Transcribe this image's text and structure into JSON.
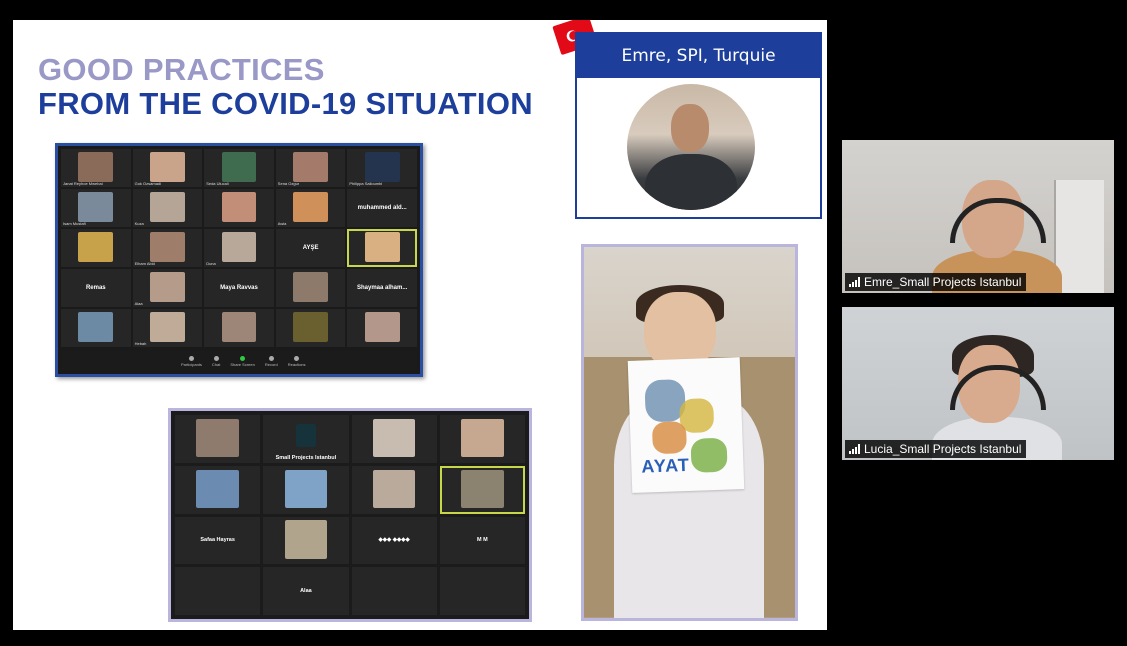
{
  "slide": {
    "title_line1": "GOOD PRACTICES",
    "title_line2": "FROM THE COVID-19 SITUATION",
    "colors": {
      "title_light": "#9a98c6",
      "title_dark": "#1d3f9b",
      "card_blue": "#1d3f9b",
      "flag_red": "#e30a17"
    }
  },
  "speaker_card": {
    "name": "Emre, SPI, Turquie",
    "flag": "turkey-flag-icon"
  },
  "grid1": {
    "tiles": [
      {
        "label": "Janat Reyhoe Mwebai",
        "name_text": "",
        "color": "#8a6b5a"
      },
      {
        "label": "Gok Ozsamadi",
        "name_text": "",
        "color": "#c9a48a"
      },
      {
        "label": "Seda Ulucali",
        "name_text": "",
        "color": "#3f6b4f"
      },
      {
        "label": "Sena Ozgur",
        "name_text": "",
        "color": "#a47b6a"
      },
      {
        "label": "Philippa Salloumbi",
        "name_text": "",
        "color": "#24344f"
      },
      {
        "label": "Isam Mustafi",
        "name_text": "",
        "color": "#7a8a9a"
      },
      {
        "label": "Kuza",
        "name_text": "",
        "color": "#b5a597"
      },
      {
        "label": "",
        "name_text": "",
        "color": "#c38e78"
      },
      {
        "label": "Awia",
        "name_text": "",
        "color": "#d0905a"
      },
      {
        "label": "",
        "name_text": "muhammed ald...",
        "color": ""
      },
      {
        "label": "",
        "name_text": "",
        "color": "#c7a24a"
      },
      {
        "label": "Elham Abid",
        "name_text": "",
        "color": "#9e7e6a"
      },
      {
        "label": "Duna",
        "name_text": "",
        "color": "#b8a89a"
      },
      {
        "label": "",
        "name_text": "AYŞE",
        "color": ""
      },
      {
        "label": "",
        "name_text": "",
        "color": "#d9b081",
        "highlight": true
      },
      {
        "label": "",
        "name_text": "Remas",
        "color": ""
      },
      {
        "label": "Alaa",
        "name_text": "",
        "color": "#b59c8a"
      },
      {
        "label": "",
        "name_text": "Maya Ravvas",
        "color": ""
      },
      {
        "label": "",
        "name_text": "",
        "color": "#8d7a6b"
      },
      {
        "label": "",
        "name_text": "Shaymaa alham...",
        "color": ""
      },
      {
        "label": "",
        "name_text": "",
        "color": "#6d8aa4"
      },
      {
        "label": "Hebah",
        "name_text": "",
        "color": "#c0aa98"
      },
      {
        "label": "",
        "name_text": "",
        "color": "#9d8577"
      },
      {
        "label": "",
        "name_text": "",
        "color": "#6a5f2e"
      },
      {
        "label": "",
        "name_text": "",
        "color": "#b3978a"
      }
    ],
    "controls": [
      "Participants",
      "Chat",
      "Share Screen",
      "Record",
      "Reactions"
    ]
  },
  "grid2": {
    "tiles": [
      {
        "name_text": "",
        "color": "#8e7b6d"
      },
      {
        "name_text": "Small Projects Istanbul",
        "color": "",
        "logo": true
      },
      {
        "name_text": "",
        "color": "#c8bcb0"
      },
      {
        "name_text": "",
        "color": "#c6a891"
      },
      {
        "name_text": "",
        "color": "#6b8bb0"
      },
      {
        "name_text": "",
        "color": "#7fa3c6"
      },
      {
        "name_text": "",
        "color": "#b9aa9b"
      },
      {
        "name_text": "",
        "color": "#8b8270",
        "highlight": true
      },
      {
        "name_text": "Safaa Hayras",
        "color": ""
      },
      {
        "name_text": "",
        "color": "#b0a48c"
      },
      {
        "name_text": "◆◆◆ ◆◆◆◆",
        "color": ""
      },
      {
        "name_text": "M M",
        "color": ""
      },
      {
        "name_text": "",
        "color": ""
      },
      {
        "name_text": "Alaa",
        "color": ""
      },
      {
        "name_text": "",
        "color": ""
      },
      {
        "name_text": "",
        "color": ""
      }
    ]
  },
  "child_photo": {
    "drawing_text": "AYAT"
  },
  "video_tiles": [
    {
      "name": "Emre_Small Projects Istanbul"
    },
    {
      "name": "Lucia_Small Projects Istanbul"
    }
  ]
}
